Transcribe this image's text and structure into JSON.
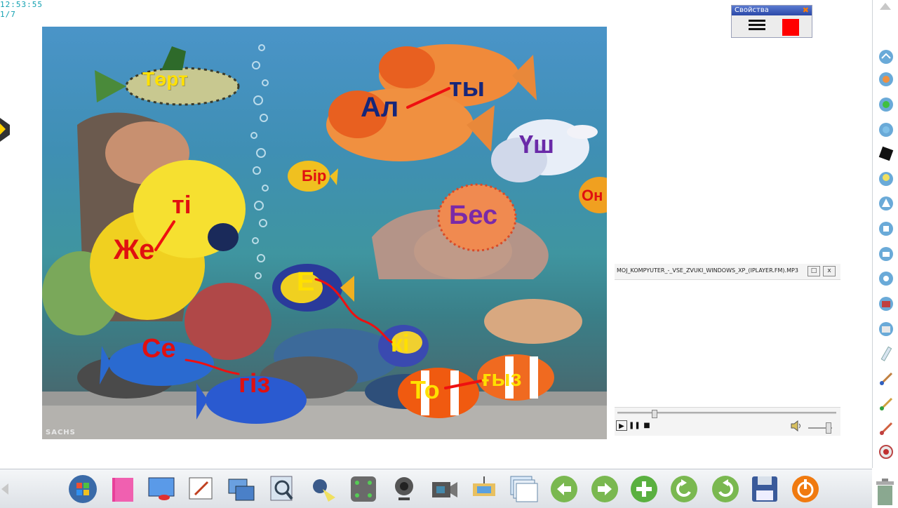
{
  "clock": {
    "time": "12:53:55",
    "page": "1/7"
  },
  "aquarium": {
    "watermark": "SACHS",
    "words": [
      {
        "id": "tort",
        "text": "Төрт",
        "color": "#ffe000"
      },
      {
        "id": "al",
        "text": "Ал",
        "color": "#16267a"
      },
      {
        "id": "ty",
        "text": "ты",
        "color": "#16267a"
      },
      {
        "id": "ush",
        "text": "Үш",
        "color": "#6a2aa8"
      },
      {
        "id": "bir",
        "text": "Бір",
        "color": "#e01010"
      },
      {
        "id": "on",
        "text": "Он",
        "color": "#e01010"
      },
      {
        "id": "ti",
        "text": "ті",
        "color": "#e01010"
      },
      {
        "id": "zhe",
        "text": "Же",
        "color": "#e01010"
      },
      {
        "id": "bes",
        "text": "Бес",
        "color": "#7a2aa8"
      },
      {
        "id": "e",
        "text": "Е",
        "color": "#ffe000"
      },
      {
        "id": "ki",
        "text": "кі",
        "color": "#ffe000"
      },
      {
        "id": "se",
        "text": "Се",
        "color": "#e01010"
      },
      {
        "id": "giz",
        "text": "гіз",
        "color": "#e01010"
      },
      {
        "id": "to",
        "text": "То",
        "color": "#ffe000"
      },
      {
        "id": "gyz",
        "text": "ғыз",
        "color": "#ffe000"
      }
    ]
  },
  "properties_panel": {
    "title": "Свойства",
    "close_icon": "close-icon",
    "line_style_icon": "line-width-icon",
    "color": "#ff0000"
  },
  "media_player": {
    "filename": "MOJ_KOMPYUTER_-_VSE_ZVUKI_WINDOWS_XP_(IPLAYER.FM).MP3",
    "seek_position": 0.16,
    "volume": 0.95
  },
  "right_toolbar": {
    "icons": [
      "scroll-up-icon",
      "pointer-tool-icon",
      "eraser-tool-icon",
      "pen-tool-icon",
      "highlighter-tool-icon",
      "black-ink-icon",
      "bulb-icon",
      "triangle-tool-icon",
      "text-tool-icon",
      "clone-tool-icon",
      "shape-tool-icon",
      "picture-tool-icon",
      "layout-tool-icon",
      "ruler-tool-icon",
      "brush-tool-icon",
      "pencil-tool-icon",
      "magic-pen-icon",
      "record-icon"
    ]
  },
  "bottom_toolbar": {
    "icons": [
      "windows-start-icon",
      "folder-icon",
      "whiteboard-icon",
      "annotate-icon",
      "screen-capture-icon",
      "magnifier-icon",
      "spotlight-icon",
      "fullscreen-icon",
      "webcam-icon",
      "video-camera-icon",
      "transfer-icon",
      "pages-icon",
      "back-arrow-icon",
      "forward-arrow-icon",
      "add-page-icon",
      "undo-icon",
      "redo-icon",
      "save-icon",
      "power-icon"
    ]
  }
}
